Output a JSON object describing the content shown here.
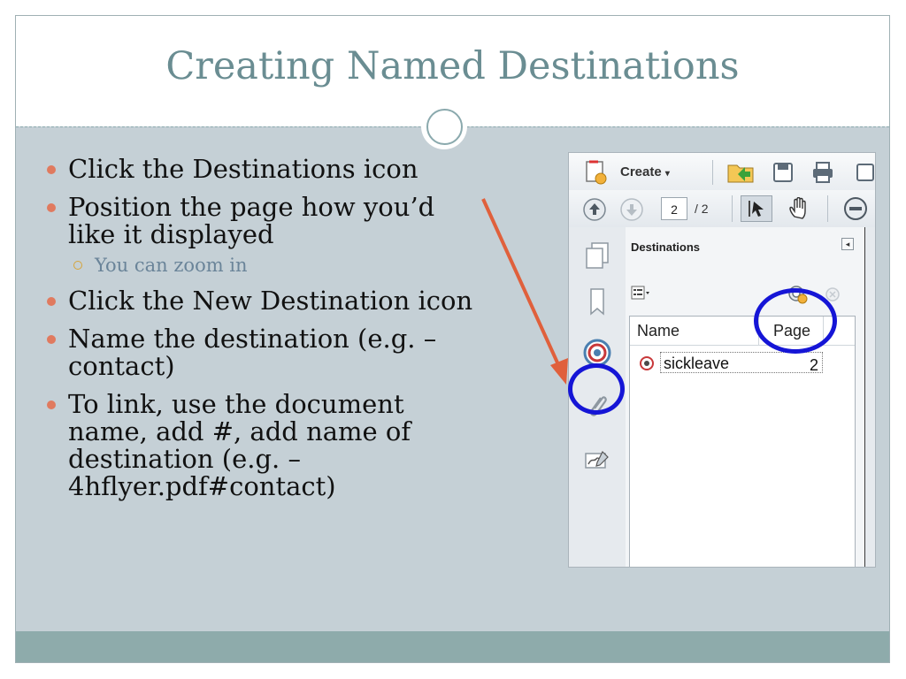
{
  "slide": {
    "title": "Creating Named Destinations",
    "bullets": [
      "Click the Destinations icon",
      "Position the page how you’d like it displayed"
    ],
    "sub_bullet": "You can zoom in",
    "bullets_after": [
      "Click the New Destination icon",
      "Name the destination (e.g. – contact)",
      "To link, use the document name, add #, add name of destination (e.g. – 4hflyer.pdf#contact)"
    ]
  },
  "colors": {
    "title": "#6a8d92",
    "bullet_dot": "#e07a5f",
    "sub_bullet_text": "#6a8499",
    "footer": "#8eabab",
    "highlight_ring": "#1515d6",
    "arrow": "#e0603c"
  },
  "screenshot": {
    "toolbar": {
      "create_label": "Create",
      "icons": [
        "create-pdf-icon",
        "open-folder-icon",
        "save-icon",
        "print-icon"
      ]
    },
    "nav_toolbar": {
      "page_current": "2",
      "page_total": "/ 2",
      "icons": [
        "prev-page-icon",
        "next-page-icon",
        "select-tool-icon",
        "hand-tool-icon",
        "zoom-out-icon"
      ]
    },
    "panel": {
      "title": "Destinations",
      "columns": {
        "name": "Name",
        "page": "Page"
      },
      "rows": [
        {
          "name": "sickleave",
          "page": "2"
        }
      ]
    },
    "left_rail_icons": [
      "pages-icon",
      "bookmark-icon",
      "destinations-icon",
      "attachment-icon",
      "signature-icon"
    ]
  }
}
